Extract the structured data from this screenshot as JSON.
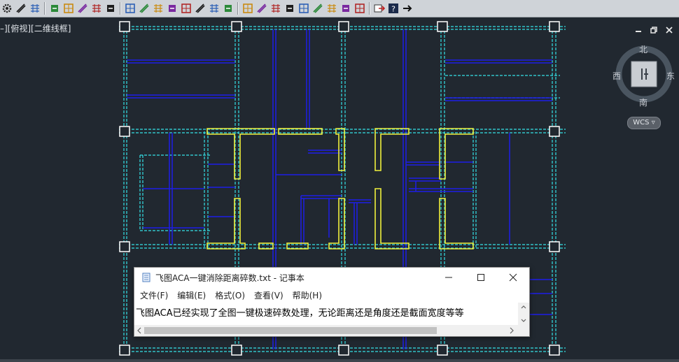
{
  "viewport": {
    "label": "–][俯视][二维线框]"
  },
  "toolbar": {
    "groups": [
      [
        "gear-icon",
        "layer-props-icon",
        "layer-manager-icon"
      ],
      [
        "pen-edit-icon",
        "grid-hatch-icon",
        "grid-snap-icon",
        "level-edit-icon",
        "column-grid-icon"
      ],
      [
        "axis-grid-icon",
        "axis-tag-icon",
        "wall-tool-icon",
        "beam-tool-icon",
        "node-snap-icon",
        "slab-tool-icon",
        "column-tool-icon",
        "opening-tool-icon"
      ],
      [
        "rebar-grid-icon",
        "section-tool-icon",
        "beam-mark-icon",
        "dimension-tool-icon",
        "dim-shrink-icon",
        "angle-tool-icon",
        "level-mark-icon",
        "check-tool-icon",
        "select-filter-icon"
      ],
      [
        "export-icon",
        "help-icon",
        "arrow-right-icon"
      ]
    ]
  },
  "compass": {
    "north": "北",
    "south": "南",
    "east": "东",
    "west": "西",
    "wcs": "WCS"
  },
  "colors": {
    "background": "#212830",
    "grid": "#35e1e6",
    "beam": "#1e1ee8",
    "wall": "#f0f03c",
    "grip": "#ffffff"
  },
  "notepad": {
    "title": "飞图ACA一键消除距离碎数.txt - 记事本",
    "menu": [
      "文件(F)",
      "编辑(E)",
      "格式(O)",
      "查看(V)",
      "帮助(H)"
    ],
    "text": "飞图ACA已经实现了全图一键极速碎数处理，无论距离还是角度还是截面宽度等等"
  }
}
